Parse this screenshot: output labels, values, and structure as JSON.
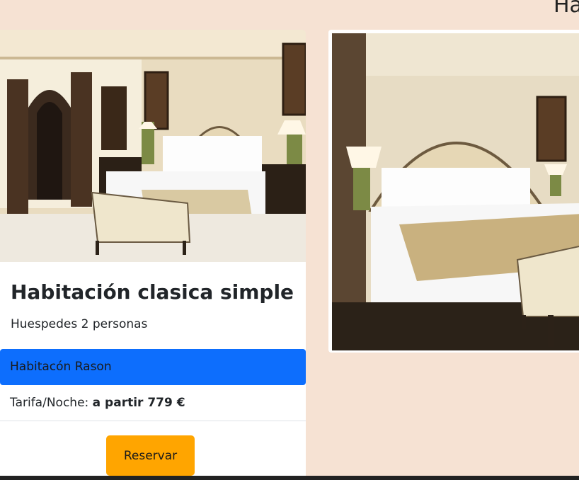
{
  "header": {
    "partial_heading": "Ha"
  },
  "room_card": {
    "photo_icon": "hotel-room-photo",
    "title": "Habitación clasica simple",
    "guests": "Huespedes 2 personas",
    "room_item": "Habitacón Rason",
    "rate_label": "Tarifa/Noche:",
    "rate_value": "a partir 779 €",
    "reserve_label": "Reservar"
  },
  "gallery": {
    "photo_icon": "hotel-room-photo"
  },
  "colors": {
    "page_bg": "#f6e2d3",
    "accent_blue": "#0d6efd",
    "button_orange": "#ffa500"
  }
}
